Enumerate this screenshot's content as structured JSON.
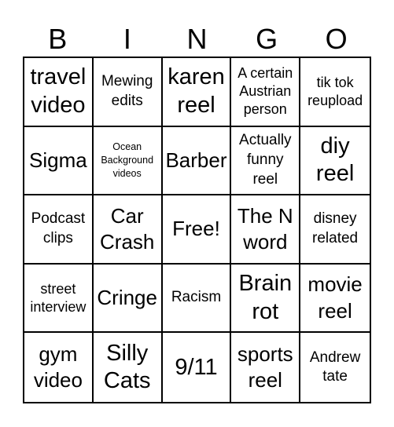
{
  "header": {
    "letters": [
      "B",
      "I",
      "N",
      "G",
      "O"
    ]
  },
  "cells": [
    {
      "text": "travel\nvideo",
      "size": "xl"
    },
    {
      "text": "Mewing\nedits",
      "size": "m"
    },
    {
      "text": "karen\nreel",
      "size": "xl"
    },
    {
      "text": "A certain\nAustrian\nperson",
      "size": "s"
    },
    {
      "text": "tik tok\nreupload",
      "size": "s"
    },
    {
      "text": "Sigma",
      "size": "l"
    },
    {
      "text": "Ocean\nBackground\nvideos",
      "size": "xs"
    },
    {
      "text": "Barber",
      "size": "l"
    },
    {
      "text": "Actually\nfunny\nreel",
      "size": "m"
    },
    {
      "text": "diy\nreel",
      "size": "xl"
    },
    {
      "text": "Podcast\nclips",
      "size": "m"
    },
    {
      "text": "Car\nCrash",
      "size": "l"
    },
    {
      "text": "Free!",
      "size": "l"
    },
    {
      "text": "The N\nword",
      "size": "l"
    },
    {
      "text": "disney\nrelated",
      "size": "m"
    },
    {
      "text": "street\ninterview",
      "size": "s"
    },
    {
      "text": "Cringe",
      "size": "l"
    },
    {
      "text": "Racism",
      "size": "m"
    },
    {
      "text": "Brain\nrot",
      "size": "xl"
    },
    {
      "text": "movie\nreel",
      "size": "l"
    },
    {
      "text": "gym\nvideo",
      "size": "l"
    },
    {
      "text": "Silly\nCats",
      "size": "xl"
    },
    {
      "text": "9/11",
      "size": "xl"
    },
    {
      "text": "sports\nreel",
      "size": "l"
    },
    {
      "text": "Andrew\ntate",
      "size": "m"
    }
  ]
}
